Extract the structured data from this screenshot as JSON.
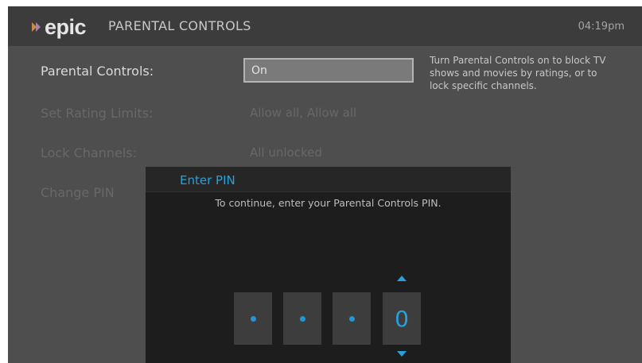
{
  "header": {
    "logo_text": "epic",
    "title": "PARENTAL CONTROLS",
    "time": "04:19pm"
  },
  "settings": {
    "parental_controls": {
      "label": "Parental Controls:",
      "value": "On",
      "help": "Turn Parental Controls on to block TV shows and movies by ratings, or to lock specific channels."
    },
    "rating_limits": {
      "label": "Set Rating Limits:",
      "value": "Allow all, Allow all"
    },
    "lock_channels": {
      "label": "Lock Channels:",
      "value": "All unlocked"
    },
    "change_pin": {
      "label": "Change PIN"
    }
  },
  "pin_dialog": {
    "title": "Enter PIN",
    "message": "To continue, enter your Parental Controls PIN.",
    "active_digit": "0"
  },
  "colors": {
    "accent": "#29a0dc",
    "dialog_bg": "#1d1d1d",
    "screen_bg": "#4e4e4e"
  },
  "icons": [
    "epic-logo-mark",
    "pin-dot-icon",
    "arrow-up-icon",
    "arrow-down-icon"
  ]
}
